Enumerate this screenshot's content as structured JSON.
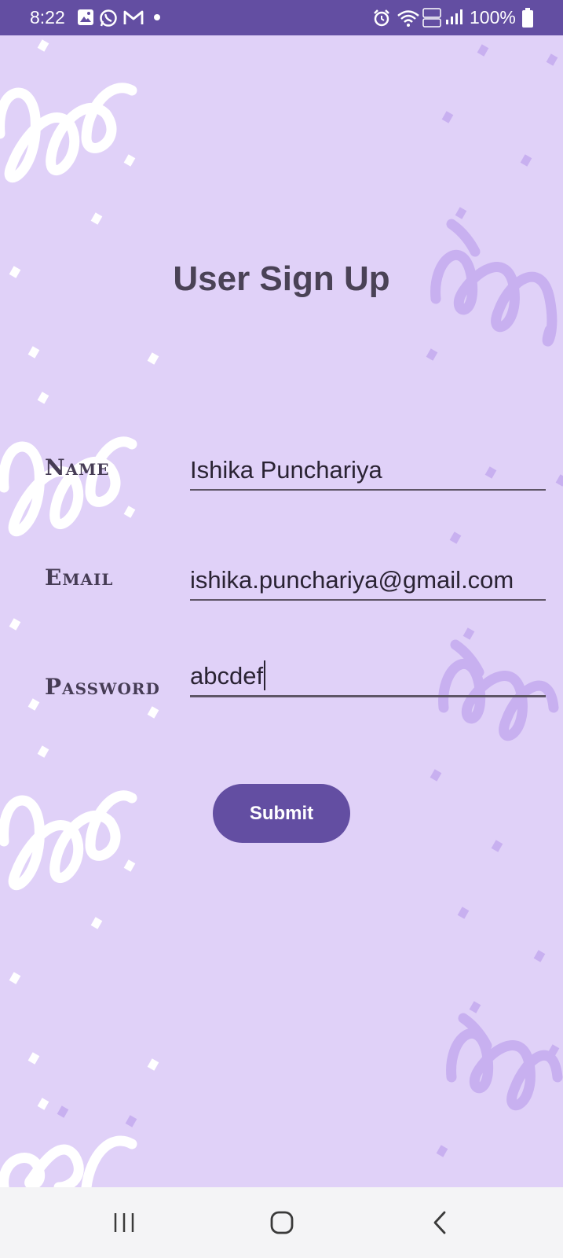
{
  "status_bar": {
    "time": "8:22",
    "battery": "100%",
    "notification_icons": [
      "gallery-icon",
      "whatsapp-icon",
      "gmail-icon",
      "dot-icon"
    ],
    "system_icons": [
      "alarm-icon",
      "wifi-icon",
      "volte-icon",
      "signal-icon",
      "battery-icon"
    ]
  },
  "page": {
    "title": "User Sign Up"
  },
  "form": {
    "name_label": "Name",
    "name_value": "Ishika Punchariya",
    "email_label": "Email",
    "email_value": "ishika.punchariya@gmail.com",
    "password_label": "Password",
    "password_value": "abcdef",
    "submit_label": "Submit"
  },
  "colors": {
    "background": "#e0d1f8",
    "accent": "#634ea2",
    "text": "#4a4256"
  },
  "nav_bar": {
    "buttons": [
      "recents-icon",
      "home-icon",
      "back-icon"
    ]
  }
}
